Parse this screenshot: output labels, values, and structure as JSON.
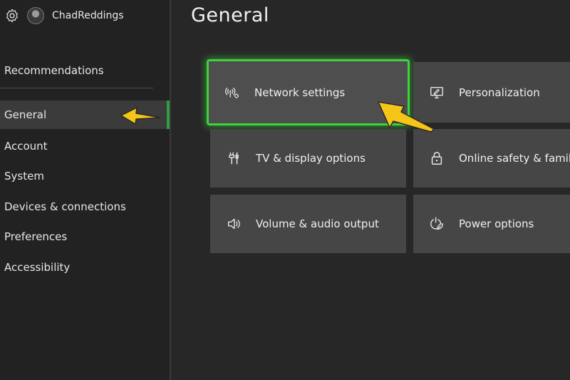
{
  "profile": {
    "username": "ChadReddings"
  },
  "sidebar": {
    "top_item": "Recommendations",
    "items": [
      {
        "label": "General",
        "active": true
      },
      {
        "label": "Account"
      },
      {
        "label": "System"
      },
      {
        "label": "Devices & connections"
      },
      {
        "label": "Preferences"
      },
      {
        "label": "Accessibility"
      }
    ]
  },
  "main": {
    "title": "General",
    "tiles": [
      {
        "label": "Network settings",
        "icon": "network-icon",
        "focused": true
      },
      {
        "label": "Personalization",
        "icon": "personalization-icon"
      },
      {
        "label": "TV & display options",
        "icon": "tv-display-icon"
      },
      {
        "label": "Online safety & family",
        "icon": "lock-icon"
      },
      {
        "label": "Volume & audio output",
        "icon": "speaker-icon"
      },
      {
        "label": "Power options",
        "icon": "power-leaf-icon"
      }
    ]
  },
  "colors": {
    "focus": "#3fd13f",
    "active_bar": "#2ea043",
    "annotation_arrow": "#f5c518",
    "tile": "#464646",
    "background": "#272727"
  }
}
